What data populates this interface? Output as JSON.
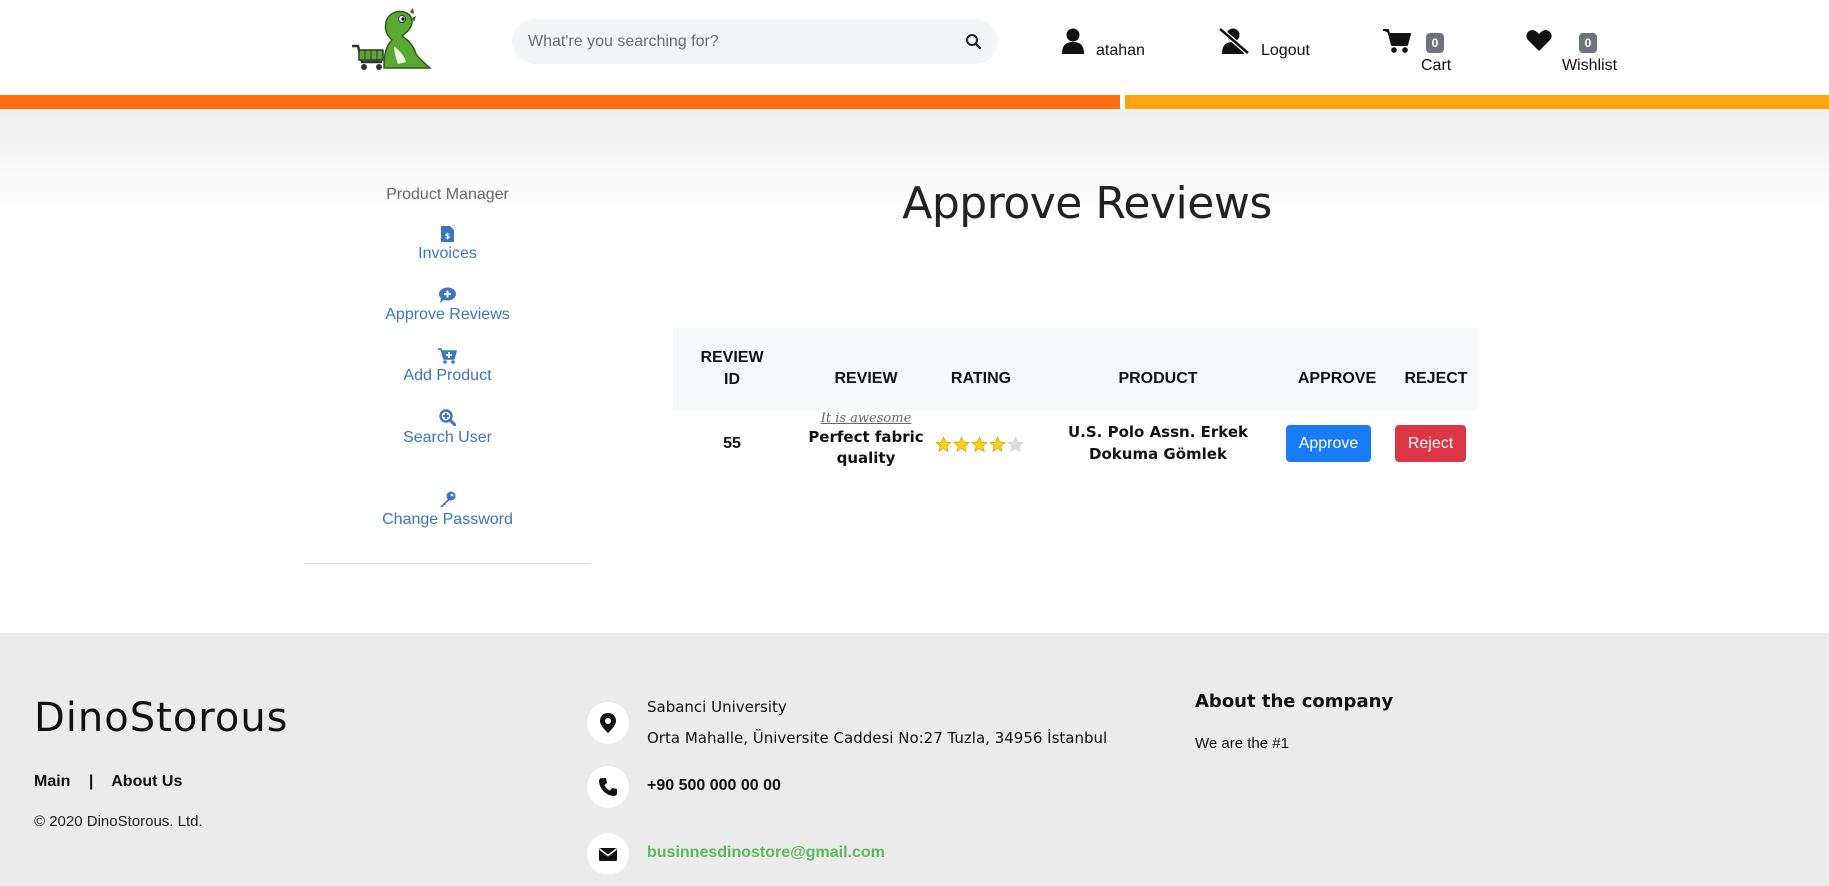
{
  "colors": {
    "accent_orange": "#ff6f0f",
    "accent_yellow": "#ffa30e",
    "link_blue": "#3a75c4",
    "approve_blue": "#1a7bf6",
    "reject_red": "#dc3545",
    "email_green": "#5cb85c",
    "star_gold": "#f5d31b",
    "star_empty": "#dcdcdc"
  },
  "header": {
    "logo_icon": "dinosaur-shopping-cart-logo",
    "search": {
      "placeholder": "What're you searching for?",
      "value": "",
      "icon": "search-icon"
    },
    "user": {
      "label": "atahan",
      "icon": "user-icon"
    },
    "logout": {
      "label": "Logout",
      "icon": "user-slash-icon"
    },
    "cart": {
      "label": "Cart",
      "count": "0",
      "icon": "cart-icon"
    },
    "wishlist": {
      "label": "Wishlist",
      "count": "0",
      "icon": "heart-icon"
    }
  },
  "sidebar": {
    "title": "Product Manager",
    "items": [
      {
        "label": "Invoices",
        "icon": "invoice-icon"
      },
      {
        "label": "Approve Reviews",
        "icon": "comment-plus-icon"
      },
      {
        "label": "Add Product",
        "icon": "cart-plus-icon"
      },
      {
        "label": "Search User",
        "icon": "search-plus-icon"
      },
      {
        "label": "Change Password",
        "icon": "key-icon"
      }
    ]
  },
  "main": {
    "title": "Approve Reviews",
    "table": {
      "headers": {
        "review_id_1": "REVIEW",
        "review_id_2": "ID",
        "review": "REVIEW",
        "rating": "RATING",
        "product": "PRODUCT",
        "approve": "APPROVE",
        "reject": "REJECT"
      },
      "rows": [
        {
          "review_id": "55",
          "review_title": "It is awesome",
          "review_body_1": "Perfect fabric",
          "review_body_2": "quality",
          "rating": 4,
          "rating_max": 5,
          "product_1": "U.S. Polo Assn. Erkek",
          "product_2": "Dokuma Gömlek",
          "approve_label": "Approve",
          "reject_label": "Reject"
        }
      ]
    }
  },
  "footer": {
    "brand": "DinoStorous",
    "links": {
      "main": "Main",
      "separator": "|",
      "about": "About Us"
    },
    "copyright": "© 2020 DinoStorous. Ltd.",
    "address_1": "Sabanci University",
    "address_2": "Orta Mahalle, Üniversite Caddesi No:27 Tuzla, 34956 İstanbul",
    "phone": "+90 500 000 00 00",
    "email": "businnesdinostore@gmail.com",
    "about_title": "About the company",
    "about_text": "We are the #1"
  }
}
